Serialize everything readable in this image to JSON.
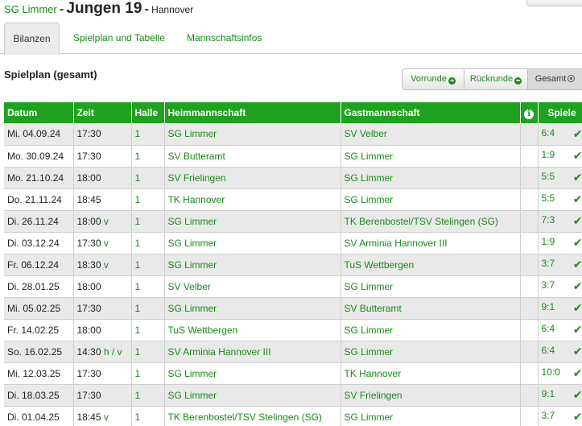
{
  "header": {
    "club": "SG Limmer",
    "sep1": "-",
    "team": "Jungen 19",
    "sep2": "-",
    "region": "Hannover"
  },
  "tabs": [
    {
      "label": "Bilanzen",
      "active": true
    },
    {
      "label": "Spielplan und Tabelle",
      "active": false
    },
    {
      "label": "Mannschaftsinfos",
      "active": false
    }
  ],
  "section_title": "Spielplan (gesamt)",
  "filters": [
    {
      "label": "Vorrunde",
      "icon": "arrow-right-circle-icon",
      "glyph": "➜"
    },
    {
      "label": "Rückrunde",
      "icon": "arrow-left-circle-icon",
      "glyph": "⬅"
    },
    {
      "label": "Gesamt",
      "icon": "radio-dot-icon",
      "glyph": ""
    }
  ],
  "table": {
    "columns": [
      "Datum",
      "Zeit",
      "Halle",
      "Heimmannschaft",
      "Gastmannschaft",
      "i",
      "Spiele"
    ],
    "rows": [
      {
        "date": "Mi. 04.09.24",
        "time": "17:30",
        "flag": "",
        "hall": "1",
        "home": "SG Limmer",
        "guest": "SV Velber",
        "score": "6:4"
      },
      {
        "date": "Mo. 30.09.24",
        "time": "17:30",
        "flag": "",
        "hall": "1",
        "home": "SV Butteramt",
        "guest": "SG Limmer",
        "score": "1:9"
      },
      {
        "date": "Mo. 21.10.24",
        "time": "18:00",
        "flag": "",
        "hall": "1",
        "home": "SV Frielingen",
        "guest": "SG Limmer",
        "score": "5:5"
      },
      {
        "date": "Do. 21.11.24",
        "time": "18:45",
        "flag": "",
        "hall": "1",
        "home": "TK Hannover",
        "guest": "SG Limmer",
        "score": "5:5"
      },
      {
        "date": "Di. 26.11.24",
        "time": "18:00",
        "flag": "v",
        "hall": "1",
        "home": "SG Limmer",
        "guest": "TK Berenbostel/TSV Stelingen (SG)",
        "score": "7:3"
      },
      {
        "date": "Di. 03.12.24",
        "time": "17:30",
        "flag": "v",
        "hall": "1",
        "home": "SG Limmer",
        "guest": "SV Arminia Hannover III",
        "score": "1:9"
      },
      {
        "date": "Fr. 06.12.24",
        "time": "18:30",
        "flag": "v",
        "hall": "1",
        "home": "SG Limmer",
        "guest": "TuS Wettbergen",
        "score": "3:7"
      },
      {
        "date": "Di. 28.01.25",
        "time": "18:00",
        "flag": "",
        "hall": "1",
        "home": "SV Velber",
        "guest": "SG Limmer",
        "score": "3:7"
      },
      {
        "date": "Mi. 05.02.25",
        "time": "17:30",
        "flag": "",
        "hall": "1",
        "home": "SG Limmer",
        "guest": "SV Butteramt",
        "score": "9:1"
      },
      {
        "date": "Fr. 14.02.25",
        "time": "18:00",
        "flag": "",
        "hall": "1",
        "home": "TuS Wettbergen",
        "guest": "SG Limmer",
        "score": "6:4"
      },
      {
        "date": "So. 16.02.25",
        "time": "14:30",
        "flag": "h / v",
        "hall": "1",
        "home": "SV Arminia Hannover III",
        "guest": "SG Limmer",
        "score": "6:4"
      },
      {
        "date": "Mi. 12.03.25",
        "time": "17:30",
        "flag": "",
        "hall": "1",
        "home": "SG Limmer",
        "guest": "TK Hannover",
        "score": "10:0"
      },
      {
        "date": "Di. 18.03.25",
        "time": "17:30",
        "flag": "",
        "hall": "1",
        "home": "SG Limmer",
        "guest": "SV Frielingen",
        "score": "9:1"
      },
      {
        "date": "Di. 01.04.25",
        "time": "18:45",
        "flag": "v",
        "hall": "1",
        "home": "TK Berenbostel/TSV Stelingen (SG)",
        "guest": "SG Limmer",
        "score": "3:7"
      }
    ]
  },
  "colors": {
    "accent": "#21a121",
    "link": "#1a8a1a",
    "row_alt": "#e9e9e9"
  }
}
